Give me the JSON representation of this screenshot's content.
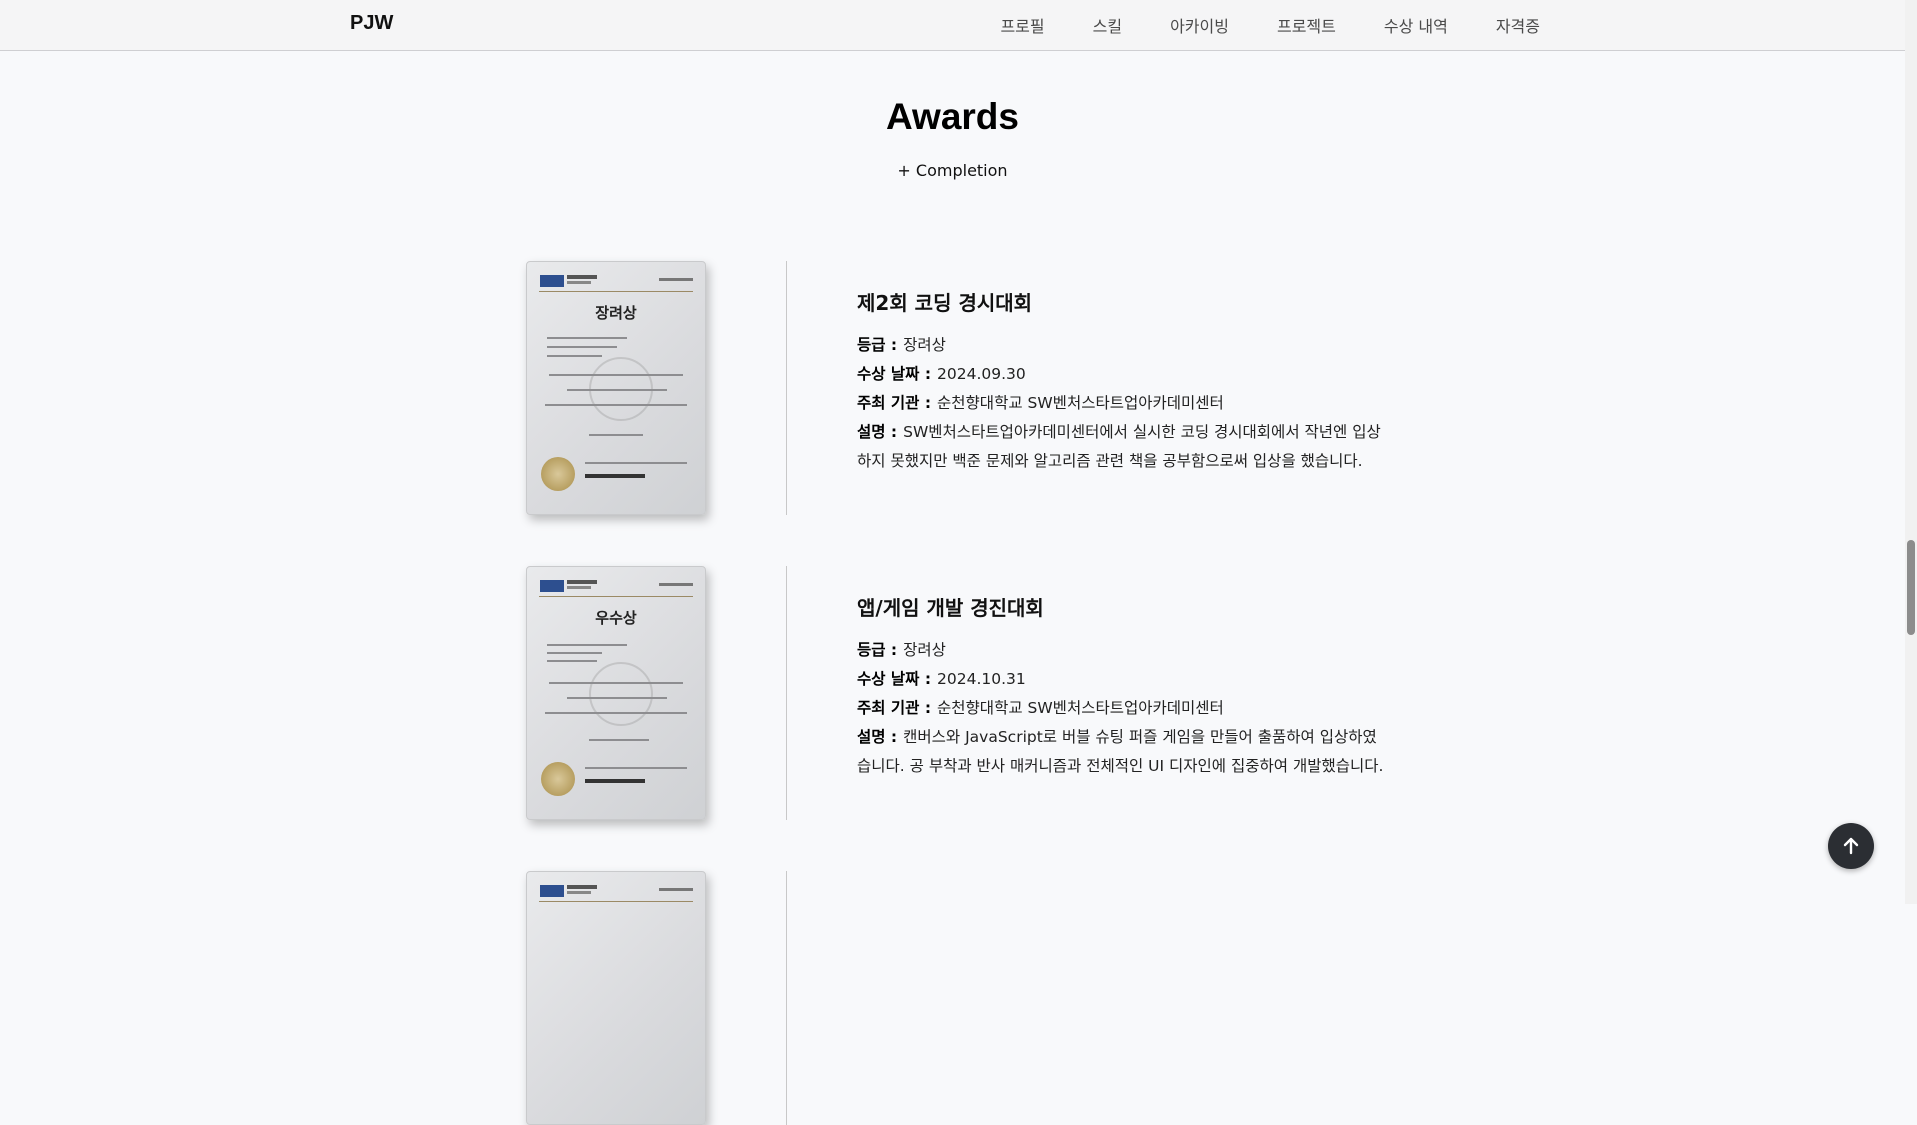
{
  "nav": {
    "brand": "PJW",
    "items": [
      "프로필",
      "스킬",
      "아카이빙",
      "프로젝트",
      "수상 내역",
      "자격증"
    ]
  },
  "section": {
    "title": "Awards",
    "toggle_label": "+ Completion"
  },
  "awards": [
    {
      "cert_title": "장려상",
      "name": "제2회 코딩 경시대회",
      "grade_label": "등급 :",
      "grade": "장려상",
      "date_label": "수상 날짜 :",
      "date": "2024.09.30",
      "org_label": "주최 기관 :",
      "org": "순천향대학교 SW벤처스타트업아카데미센터",
      "desc_label": "설명 :",
      "desc": "SW벤처스타트업아카데미센터에서 실시한 코딩 경시대회에서 작년엔 입상하지 못했지만 백준 문제와 알고리즘 관련 책을 공부함으로써 입상을 했습니다."
    },
    {
      "cert_title": "우수상",
      "name": "앱/게임 개발 경진대회",
      "grade_label": "등급 :",
      "grade": "장려상",
      "date_label": "수상 날짜 :",
      "date": "2024.10.31",
      "org_label": "주최 기관 :",
      "org": "순천향대학교 SW벤처스타트업아카데미센터",
      "desc_label": "설명 :",
      "desc": "캔버스와 JavaScript로 버블 슈팅 퍼즐 게임을 만들어 출품하여 입상하였습니다. 공 부착과 반사 매커니즘과 전체적인 UI 디자인에 집중하여 개발했습니다."
    }
  ],
  "icons": {
    "scroll_top": "arrow-up-icon"
  }
}
